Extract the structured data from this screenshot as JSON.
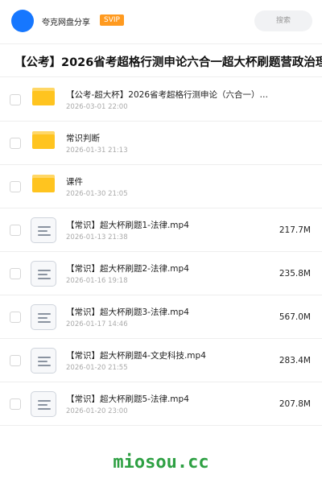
{
  "header": {
    "brand": "夸克网盘分享",
    "badge": "SVIP",
    "search_label": "搜索"
  },
  "title": "【公考】2026省考超格行测申论六合一超大杯刷题营政治理",
  "files": [
    {
      "type": "folder",
      "name": "【公考-超大杯】2026省考超格行测申论（六合一）…",
      "date": "2026-03-01 22:00",
      "size": ""
    },
    {
      "type": "folder",
      "name": "常识判断",
      "date": "2026-01-31 21:13",
      "size": ""
    },
    {
      "type": "folder",
      "name": "课件",
      "date": "2026-01-30 21:05",
      "size": ""
    },
    {
      "type": "doc",
      "name": "【常识】超大杯刷题1-法律.mp4",
      "date": "2026-01-13 21:38",
      "size": "217.7M"
    },
    {
      "type": "doc",
      "name": "【常识】超大杯刷题2-法律.mp4",
      "date": "2026-01-16 19:18",
      "size": "235.8M"
    },
    {
      "type": "doc",
      "name": "【常识】超大杯刷题3-法律.mp4",
      "date": "2026-01-17 14:46",
      "size": "567.0M"
    },
    {
      "type": "doc",
      "name": "【常识】超大杯刷题4-文史科技.mp4",
      "date": "2026-01-20 21:55",
      "size": "283.4M"
    },
    {
      "type": "doc",
      "name": "【常识】超大杯刷题5-法律.mp4",
      "date": "2026-01-20 23:00",
      "size": "207.8M"
    }
  ],
  "footer": {
    "watermark": "miosou.cc"
  },
  "colors": {
    "accent": "#1677ff",
    "badge": "#ff9a1f",
    "folder": "#ffc41f",
    "watermark": "#2ea043"
  }
}
